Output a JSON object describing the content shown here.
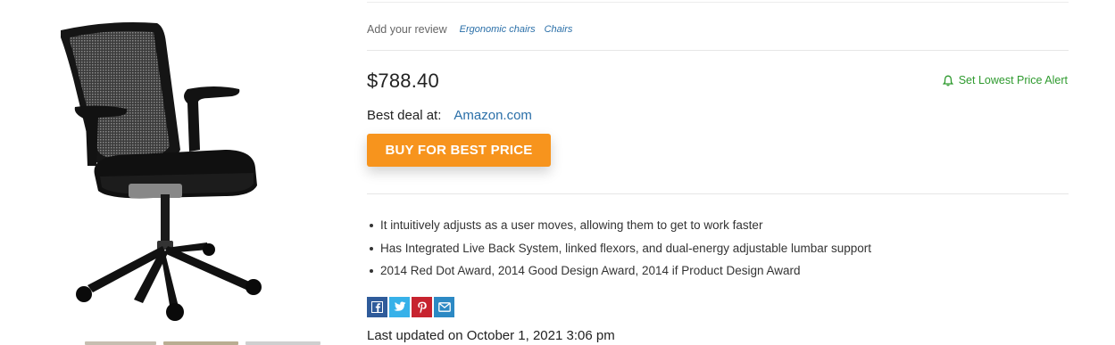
{
  "review": {
    "add_review_label": "Add your review",
    "tags": [
      "Ergonomic chairs",
      "Chairs"
    ]
  },
  "price": "$788.40",
  "alert": {
    "label": "Set Lowest Price Alert",
    "icon": "bell-icon",
    "color": "#2e9a2e"
  },
  "deal": {
    "label": "Best deal at:",
    "store": "Amazon.com"
  },
  "buy_button": {
    "label": "BUY FOR BEST PRICE",
    "color": "#f7941d"
  },
  "features": [
    "It intuitively adjusts as a user moves, allowing them to get to work faster",
    "Has Integrated Live Back System, linked flexors, and dual-energy adjustable lumbar support",
    "2014 Red Dot Award, 2014 Good Design Award, 2014 if Product Design Award"
  ],
  "share": [
    {
      "name": "facebook-icon",
      "color": "#2f5b9a"
    },
    {
      "name": "twitter-icon",
      "color": "#37b1e9"
    },
    {
      "name": "pinterest-icon",
      "color": "#c7232f"
    },
    {
      "name": "email-icon",
      "color": "#2c89c4"
    }
  ],
  "last_updated": "Last updated on October 1, 2021 3:06 pm"
}
